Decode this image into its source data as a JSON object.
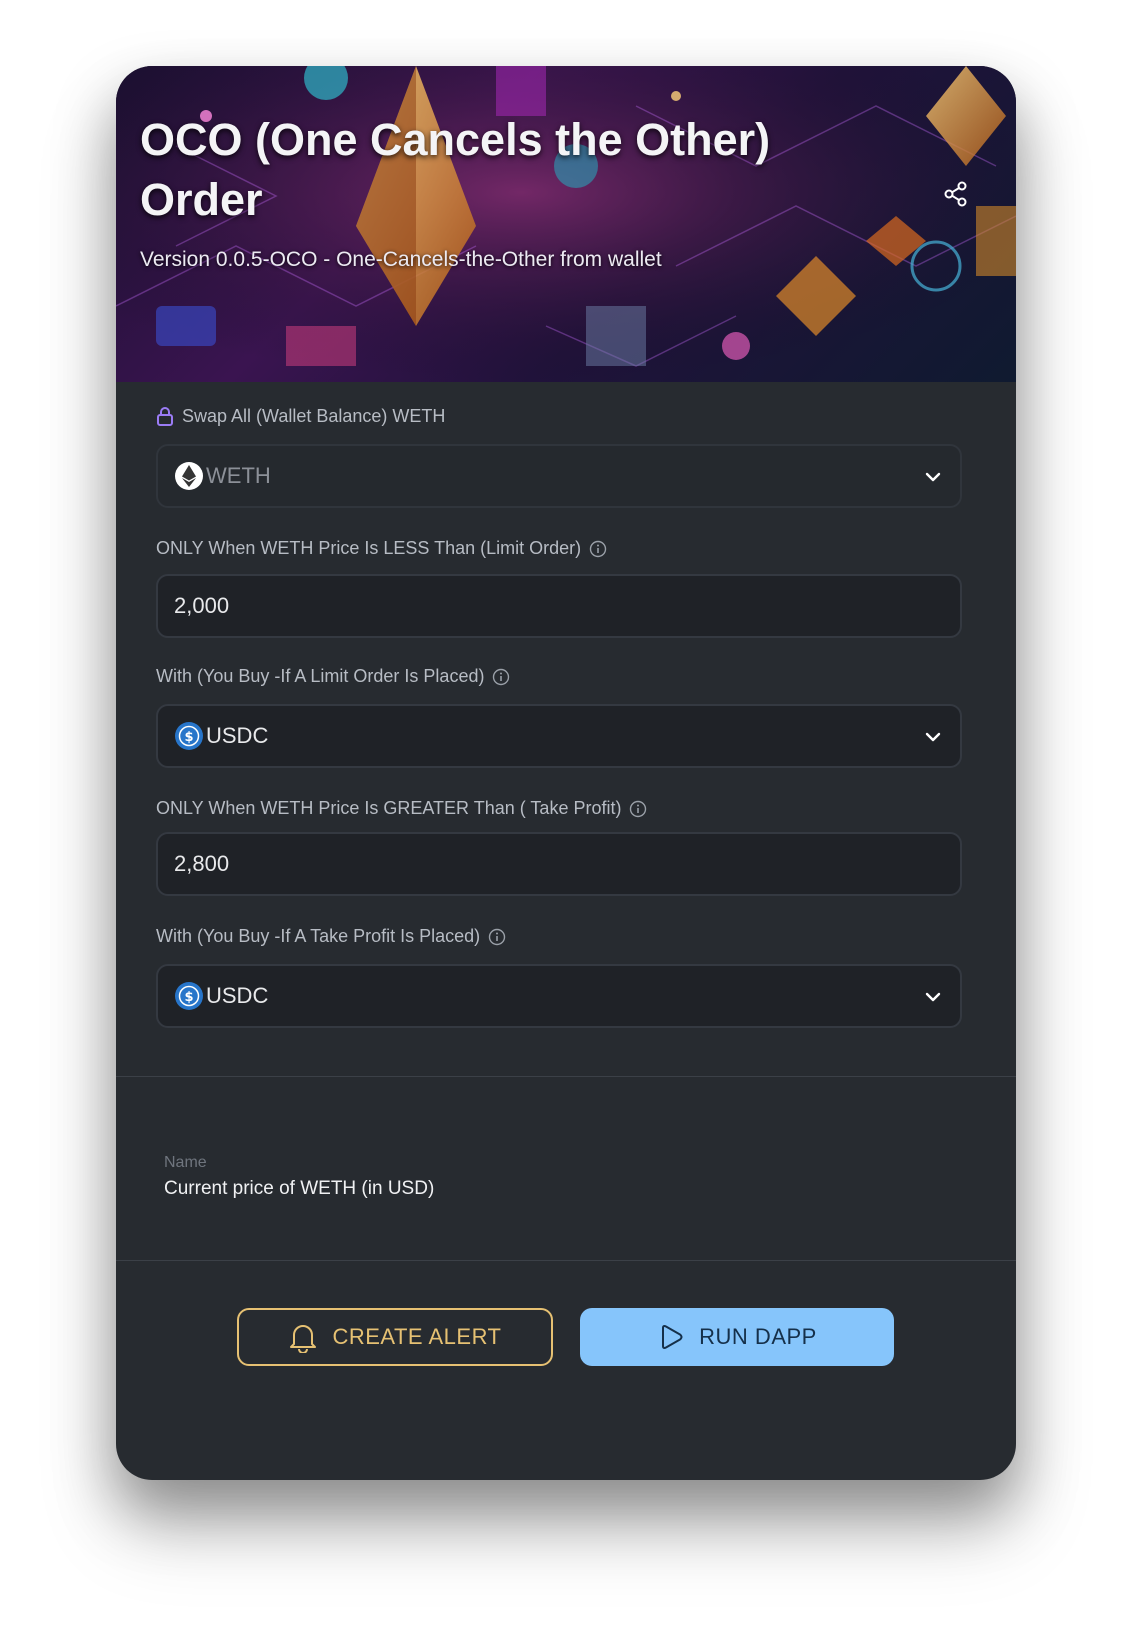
{
  "header": {
    "title": "OCO (One Cancels the Other) Order",
    "subtitle": "Version 0.0.5-OCO - One-Cancels-the-Other from wallet"
  },
  "form": {
    "swap": {
      "label": "Swap All (Wallet Balance) WETH",
      "value": "WETH",
      "icon": "eth-token-icon"
    },
    "limit_price": {
      "label": "ONLY When WETH Price Is LESS Than (Limit Order)",
      "value": "2,000"
    },
    "limit_token": {
      "label": "With (You Buy -If A Limit Order Is Placed)",
      "value": "USDC",
      "icon": "usdc-token-icon"
    },
    "tp_price": {
      "label": "ONLY When WETH Price Is GREATER Than ( Take Profit)",
      "value": "2,800"
    },
    "tp_token": {
      "label": "With (You Buy -If A Take Profit Is Placed)",
      "value": "USDC",
      "icon": "usdc-token-icon"
    }
  },
  "info": {
    "name_label": "Name",
    "name_value": "Current price of WETH (in USD)"
  },
  "buttons": {
    "create_alert": "CREATE ALERT",
    "run_dapp": "RUN DAPP"
  },
  "colors": {
    "card_bg": "#272b30",
    "accent_gold": "#e6c173",
    "accent_blue": "#86c5fb",
    "usdc": "#2775ca"
  }
}
